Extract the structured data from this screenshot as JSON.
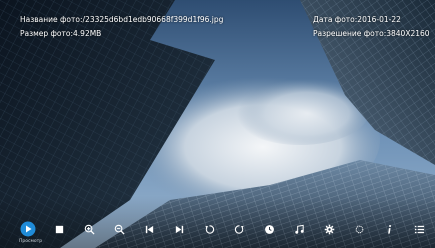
{
  "info": {
    "name_label": "Название фото:",
    "name_value": "/23325d6bd1edb90668f399d1f96.jpg",
    "size_label": "Размер фото:",
    "size_value": "4.92MB",
    "date_label": "Дата фото:",
    "date_value": "2016-01-22",
    "resolution_label": "Разрешение фото:",
    "resolution_value": "3840X2160"
  },
  "toolbar": {
    "play_caption": "Просмотр",
    "icons": [
      "play-icon",
      "stop-icon",
      "zoom-in-icon",
      "zoom-out-icon",
      "previous-icon",
      "next-icon",
      "rotate-left-icon",
      "rotate-right-icon",
      "clock-icon",
      "music-icon",
      "gear-icon",
      "circle-icon",
      "info-icon",
      "list-icon"
    ]
  },
  "colors": {
    "accent": "#1f8bd8",
    "text": "#ffffff"
  }
}
